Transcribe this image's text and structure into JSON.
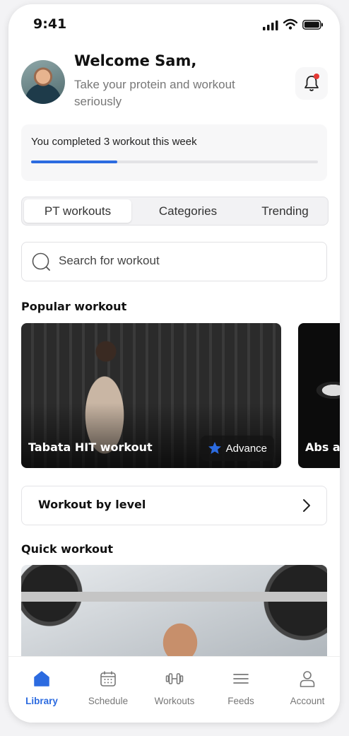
{
  "status_bar": {
    "time": "9:41"
  },
  "header": {
    "welcome": "Welcome Sam,",
    "subtitle": "Take your protein and workout seriously"
  },
  "progress": {
    "text": "You completed 3 workout this week",
    "fraction": 0.3
  },
  "tabs": [
    {
      "label": "PT workouts",
      "active": true
    },
    {
      "label": "Categories",
      "active": false
    },
    {
      "label": "Trending",
      "active": false
    }
  ],
  "search": {
    "placeholder": "Search for workout"
  },
  "popular": {
    "title": "Popular workout",
    "cards": [
      {
        "title": "Tabata HIT workout",
        "badge": "Advance"
      },
      {
        "title": "Abs a"
      }
    ]
  },
  "level_row": {
    "label": "Workout by level"
  },
  "quick": {
    "title": "Quick workout"
  },
  "nav": [
    {
      "label": "Library",
      "icon": "home-icon",
      "active": true
    },
    {
      "label": "Schedule",
      "icon": "calendar-icon",
      "active": false
    },
    {
      "label": "Workouts",
      "icon": "dumbbell-icon",
      "active": false
    },
    {
      "label": "Feeds",
      "icon": "feed-icon",
      "active": false
    },
    {
      "label": "Account",
      "icon": "user-icon",
      "active": false
    }
  ],
  "colors": {
    "accent": "#2c6be0",
    "notification": "#e53935"
  }
}
